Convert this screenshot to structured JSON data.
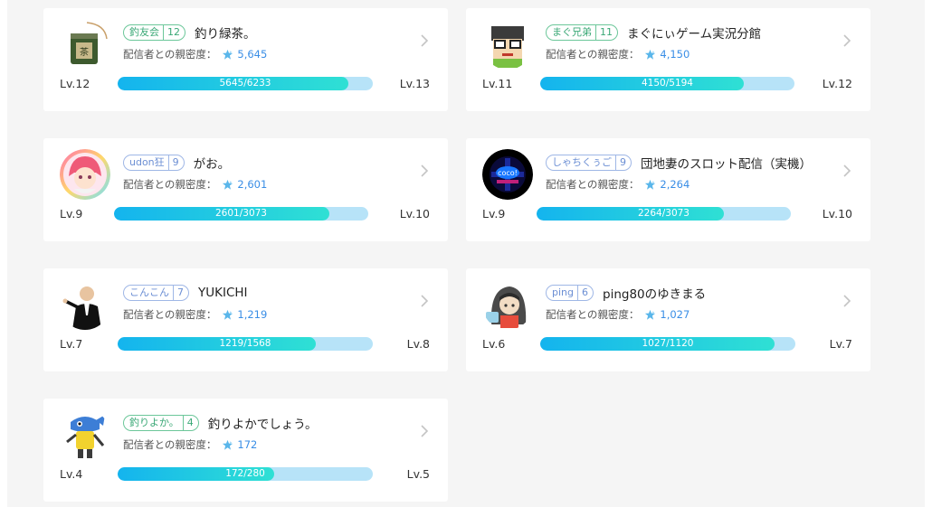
{
  "affinity_label": "配信者との親密度：",
  "cards": [
    {
      "badge": {
        "name": "釣友会",
        "level": "12",
        "color": "green"
      },
      "name": "釣り緑茶。",
      "affinity": "5,645",
      "lv_current": "Lv.12",
      "lv_next": "Lv.13",
      "progress_text": "5645/6233",
      "progress": 0.906,
      "avatar": "green-tea-can-avatar"
    },
    {
      "badge": {
        "name": "まぐ兄弟",
        "level": "11",
        "color": "green"
      },
      "name": "まぐにぃゲーム実況分館",
      "affinity": "4,150",
      "lv_current": "Lv.11",
      "lv_next": "Lv.12",
      "progress_text": "4150/5194",
      "progress": 0.799,
      "avatar": "pixel-character-avatar"
    },
    {
      "badge": {
        "name": "udon狂",
        "level": "9",
        "color": "blue"
      },
      "name": "がお。",
      "affinity": "2,601",
      "lv_current": "Lv.9",
      "lv_next": "Lv.10",
      "progress_text": "2601/3073",
      "progress": 0.846,
      "avatar": "anime-girl-avatar"
    },
    {
      "badge": {
        "name": "しゃちくぅご",
        "level": "9",
        "color": "blue"
      },
      "name": "団地妻のスロット配信（実機）",
      "affinity": "2,264",
      "lv_current": "Lv.9",
      "lv_next": "Lv.10",
      "progress_text": "2264/3073",
      "progress": 0.737,
      "avatar": "neon-logo-avatar"
    },
    {
      "badge": {
        "name": "こんこん",
        "level": "7",
        "color": "blue"
      },
      "name": "YUKICHI",
      "affinity": "1,219",
      "lv_current": "Lv.7",
      "lv_next": "Lv.8",
      "progress_text": "1219/1568",
      "progress": 0.777,
      "avatar": "man-in-suit-avatar"
    },
    {
      "badge": {
        "name": "ping",
        "level": "6",
        "color": "blue"
      },
      "name": "ping80のゆきまる",
      "affinity": "1,027",
      "lv_current": "Lv.6",
      "lv_next": "Lv.7",
      "progress_text": "1027/1120",
      "progress": 0.917,
      "avatar": "hooded-character-avatar"
    },
    {
      "badge": {
        "name": "釣りよか。",
        "level": "4",
        "color": "green"
      },
      "name": "釣りよかでしょう。",
      "affinity": "172",
      "lv_current": "Lv.4",
      "lv_next": "Lv.5",
      "progress_text": "172/280",
      "progress": 0.614,
      "avatar": "fish-mascot-avatar"
    }
  ]
}
